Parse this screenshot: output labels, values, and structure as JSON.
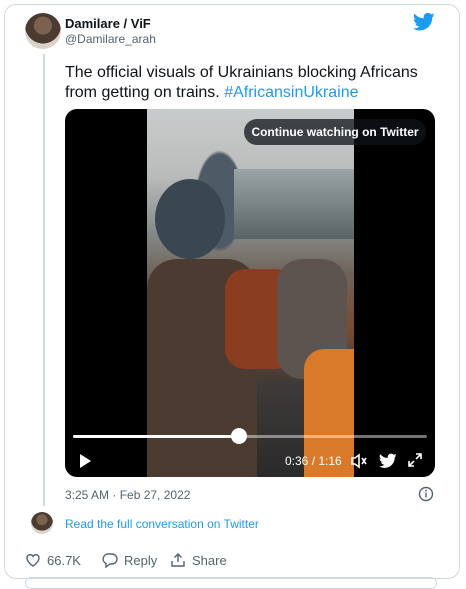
{
  "author": {
    "display_name": "Damilare / ViF",
    "handle": "@Damilare_arah"
  },
  "tweet": {
    "text": "The official visuals of Ukrainians blocking Africans from getting on trains.",
    "hashtag": "#AfricansinUkraine"
  },
  "video": {
    "overlay_button": "Continue watching on Twitter",
    "time": "0:36 / 1:16",
    "progress": 0.47
  },
  "meta": {
    "timestamp": "3:25 AM · Feb 27, 2022"
  },
  "conversation": {
    "link": "Read the full conversation on Twitter"
  },
  "actions": {
    "likes": "66.7K",
    "reply": "Reply",
    "share": "Share"
  },
  "colors": {
    "accent": "#1d9bf0",
    "muted": "#536471",
    "border": "#cfd9de"
  }
}
